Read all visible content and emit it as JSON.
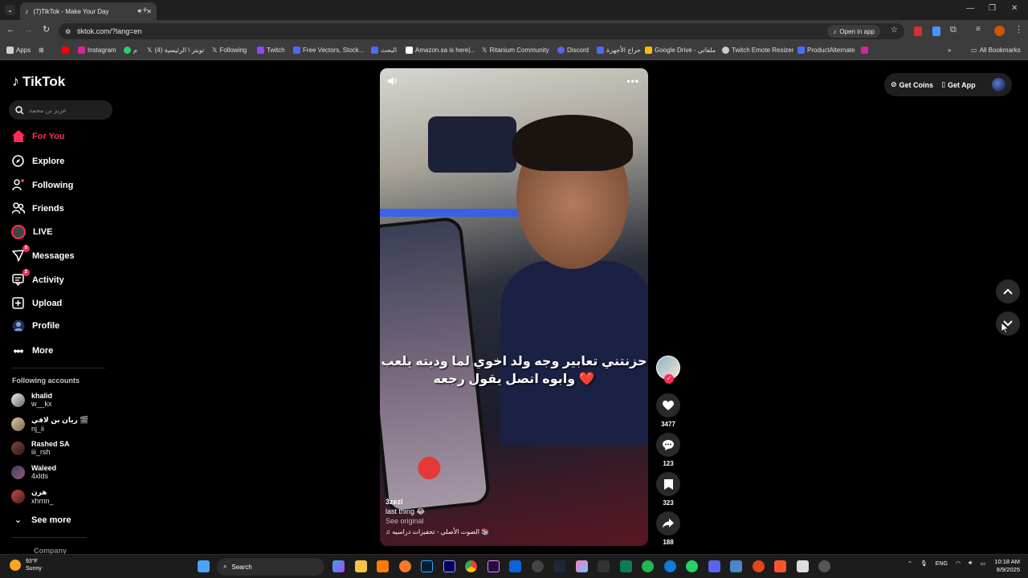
{
  "browser": {
    "tab_title": "(7)TikTok - Make Your Day",
    "url": "tiktok.com/?lang=en",
    "open_in_app": "Open in app",
    "bookmarks": [
      {
        "label": "Apps",
        "color": "#cfcfcf"
      },
      {
        "label": "",
        "color": "#ff0000"
      },
      {
        "label": "Instagram",
        "color": "#d6249f"
      },
      {
        "label": "م",
        "color": "#25d366"
      },
      {
        "label": "تويتر \\ الرئيسية (4)",
        "color": "#ffffff"
      },
      {
        "label": "Following",
        "color": "#ffffff"
      },
      {
        "label": "Twitch",
        "color": "#9146ff"
      },
      {
        "label": "Free Vectors, Stock...",
        "color": "#4a6cf7"
      },
      {
        "label": "البحث",
        "color": "#4a6cf7"
      },
      {
        "label": "Amazon.sa is here|...",
        "color": "#ffffff"
      },
      {
        "label": "Ritanium Community",
        "color": "#ffffff"
      },
      {
        "label": "Discord",
        "color": "#5865f2"
      },
      {
        "label": "حراج الأجهزة",
        "color": "#4a6cf7"
      },
      {
        "label": "Google Drive - ملفاتي",
        "color": "#fbbc04"
      },
      {
        "label": "Twitch Emote Resizer",
        "color": "#cccccc"
      },
      {
        "label": "ProductAlternate",
        "color": "#4a6cf7"
      },
      {
        "label": "",
        "color": "#d6249f"
      }
    ],
    "all_bookmarks": "All Bookmarks"
  },
  "sidebar": {
    "logo": "TikTok",
    "search_placeholder": "عزيز بن محمد",
    "nav": [
      {
        "label": "For You",
        "icon": "home-icon",
        "active": true
      },
      {
        "label": "Explore",
        "icon": "compass-icon"
      },
      {
        "label": "Following",
        "icon": "following-icon"
      },
      {
        "label": "Friends",
        "icon": "friends-icon"
      },
      {
        "label": "LIVE",
        "icon": "live-icon"
      },
      {
        "label": "Messages",
        "icon": "messages-icon",
        "badge": "5"
      },
      {
        "label": "Activity",
        "icon": "activity-icon",
        "badge": "2"
      },
      {
        "label": "Upload",
        "icon": "upload-icon"
      },
      {
        "label": "Profile",
        "icon": "profile-icon"
      },
      {
        "label": "More",
        "icon": "more-icon"
      }
    ],
    "following_header": "Following accounts",
    "accounts": [
      {
        "name": "khalid",
        "handle": "w__kx"
      },
      {
        "name": "ريان بن لافي 🎬",
        "handle": "nj_ii"
      },
      {
        "name": "Rashed SA",
        "handle": "iii_rsh"
      },
      {
        "name": "Waleed",
        "handle": "4xlds"
      },
      {
        "name": "هرن",
        "handle": "xhrnn_"
      }
    ],
    "see_more": "See more",
    "company": "Company"
  },
  "video": {
    "caption_line1": "حزنتني تعابير وجه ولد اخوي لما وديته يلعب",
    "caption_line2": "وابوه اتصل يقول رجعه ❤️",
    "username": "3zezl",
    "description": "last thing 😂",
    "see_original": "See original",
    "sound": "♫ الصوت الأصلي - تحفيزات دراسيه 📚"
  },
  "actions": {
    "likes": "3477",
    "comments": "123",
    "saves": "323",
    "shares": "188"
  },
  "topbar": {
    "get_coins": "Get Coins",
    "get_app": "Get App"
  },
  "taskbar": {
    "temp": "93°F",
    "condition": "Sunny",
    "search": "Search",
    "lang": "ENG",
    "time": "10:18 AM",
    "date": "8/9/2025"
  },
  "colors": {
    "accent": "#fe2c55",
    "bg": "#000000"
  }
}
